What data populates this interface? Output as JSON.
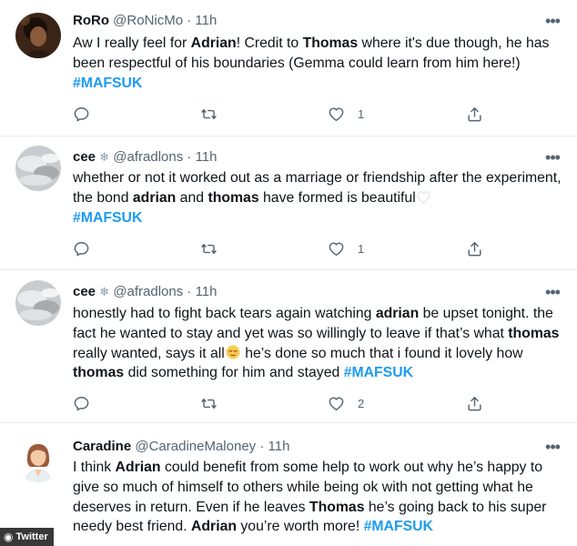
{
  "tweets": [
    {
      "name": "RoRo",
      "handle": "@RoNicMo",
      "dot": "·",
      "time": "11h",
      "body_parts": [
        {
          "t": "Aw I really feel for "
        },
        {
          "t": "Adrian",
          "b": true
        },
        {
          "t": "! Credit to "
        },
        {
          "t": "Thomas",
          "b": true
        },
        {
          "t": " where it's due though, he has been respectful of his boundaries (Gemma could learn from him here!)"
        },
        {
          "br": true
        },
        {
          "t": "#MAFSUK",
          "tag": true
        }
      ],
      "reply_count": "",
      "retweet_count": "",
      "like_count": "1"
    },
    {
      "name": "cee",
      "handle": "@afradlons",
      "dot": "·",
      "time": "11h",
      "body_parts": [
        {
          "t": "whether or not it worked out as a marriage or friendship after the experiment, the bond "
        },
        {
          "t": "adrian",
          "b": true
        },
        {
          "t": " and "
        },
        {
          "t": "thomas",
          "b": true
        },
        {
          "t": " have formed is beautiful"
        },
        {
          "emoji": "white-heart"
        },
        {
          "br": true
        },
        {
          "t": "#MAFSUK",
          "tag": true
        }
      ],
      "reply_count": "",
      "retweet_count": "",
      "like_count": "1"
    },
    {
      "name": "cee",
      "handle": "@afradlons",
      "dot": "·",
      "time": "11h",
      "body_parts": [
        {
          "t": "honestly had to fight back tears again  watching "
        },
        {
          "t": "adrian",
          "b": true
        },
        {
          "t": " be upset tonight. the fact he wanted to stay and yet was so willingly to leave if that’s what "
        },
        {
          "t": "thomas",
          "b": true
        },
        {
          "t": " really wanted, says it all"
        },
        {
          "emoji": "relieved-face"
        },
        {
          "t": " he’s done so much that i found it lovely how "
        },
        {
          "t": "thomas",
          "b": true
        },
        {
          "t": " did something for him and stayed "
        },
        {
          "t": "#MAFSUK",
          "tag": true
        }
      ],
      "reply_count": "",
      "retweet_count": "",
      "like_count": "2"
    },
    {
      "name": "Caradine",
      "handle": "@CaradineMaloney",
      "dot": "·",
      "time": "11h",
      "body_parts": [
        {
          "t": "I think "
        },
        {
          "t": "Adrian",
          "b": true
        },
        {
          "t": " could benefit from some help to work out why he’s happy to give so much of himself to others while being ok with not getting what he deserves in return. Even if he leaves "
        },
        {
          "t": "Thomas",
          "b": true
        },
        {
          "t": " he’s going back to his super needy best friend. "
        },
        {
          "t": "Adrian",
          "b": true
        },
        {
          "t": " you’re worth more! "
        },
        {
          "t": "#MAFSUK",
          "tag": true
        }
      ]
    }
  ],
  "watermark": "Twitter",
  "colors": {
    "hashtag": "#1d9bf0",
    "muted": "#536471",
    "divider": "#e6ecf0"
  }
}
